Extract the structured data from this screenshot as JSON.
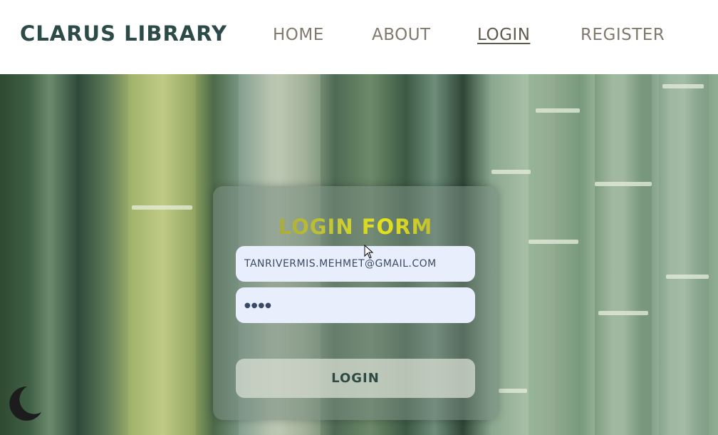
{
  "navbar": {
    "brand": "CLARUS LIBRARY",
    "links": [
      {
        "label": "HOME",
        "active": false
      },
      {
        "label": "ABOUT",
        "active": false
      },
      {
        "label": "LOGIN",
        "active": true
      },
      {
        "label": "REGISTER",
        "active": false
      }
    ]
  },
  "login_form": {
    "title": "LOGIN FORM",
    "email_value": "TANRIVERMIS.MEHMET@GMAIL.COM",
    "password_value": "●●●●",
    "submit_label": "LOGIN"
  },
  "icons": {
    "theme_toggle": "moon-icon",
    "cursor": "mouse-pointer-icon"
  },
  "colors": {
    "brand": "#2b4a48",
    "nav_link": "#7f7a6c",
    "input_bg": "#e8eefb",
    "button_text": "#2f4a45",
    "title_gradient_mid": "#e5e31a"
  }
}
